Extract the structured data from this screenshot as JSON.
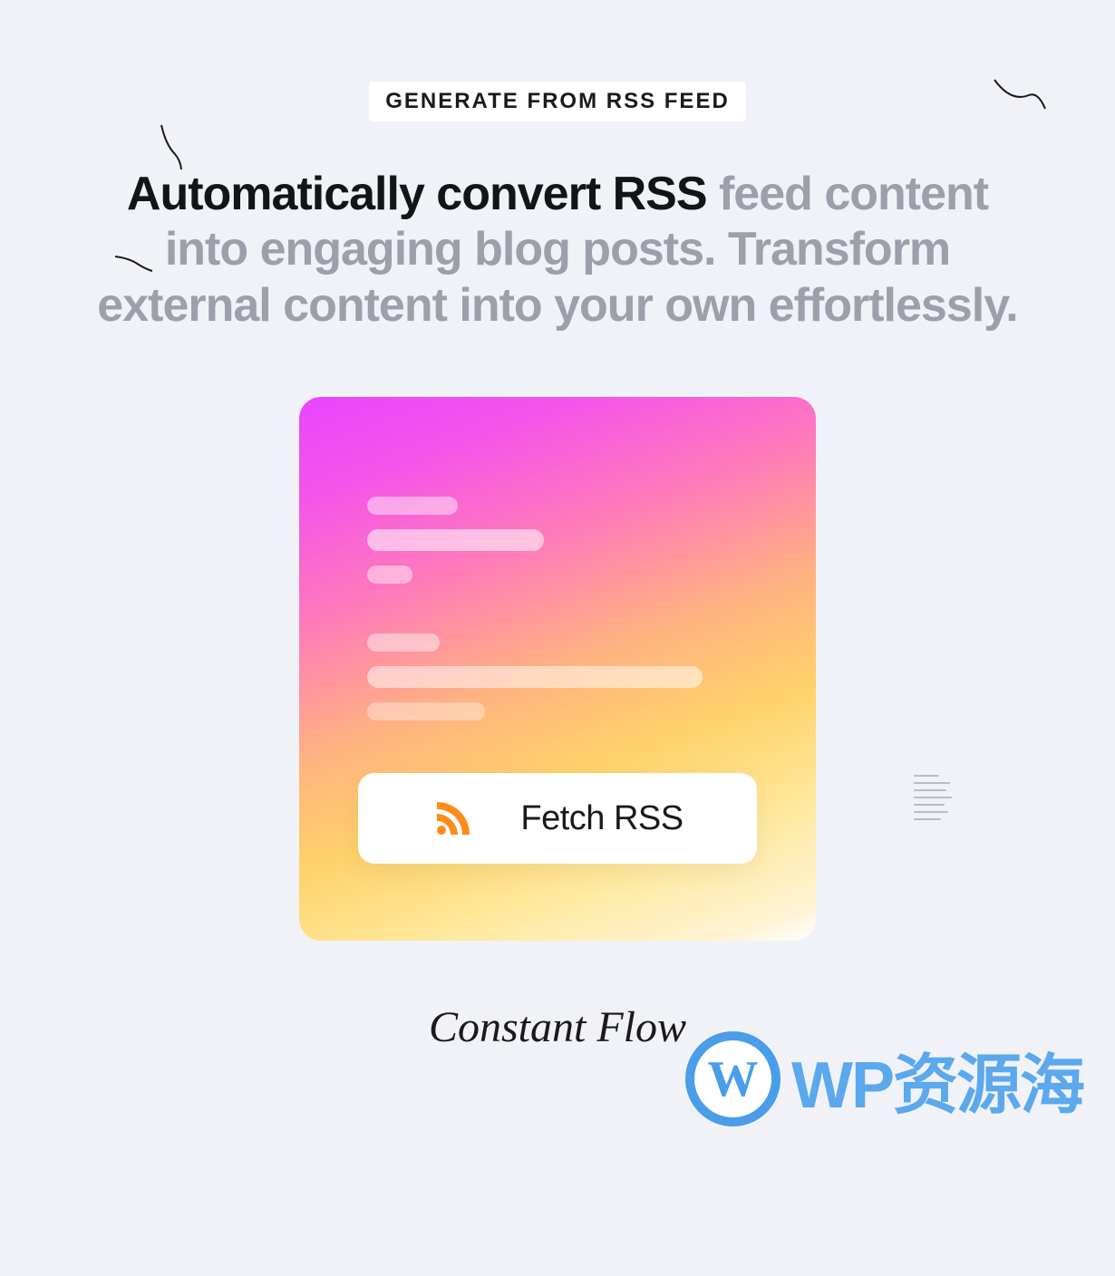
{
  "badge": "GENERATE FROM RSS FEED",
  "headline": {
    "dark": "Automatically convert RSS",
    "light": " feed content into engaging blog posts. Transform external content into your own effortlessly."
  },
  "button": {
    "label": "Fetch RSS",
    "icon_name": "rss-icon"
  },
  "footer": "Constant Flow",
  "watermark": {
    "text": "WP资源海"
  },
  "colors": {
    "accent_orange": "#ff8c1a",
    "text_dark": "#121418",
    "text_muted": "#9ba0aa",
    "watermark_blue": "#5ba8ed"
  }
}
